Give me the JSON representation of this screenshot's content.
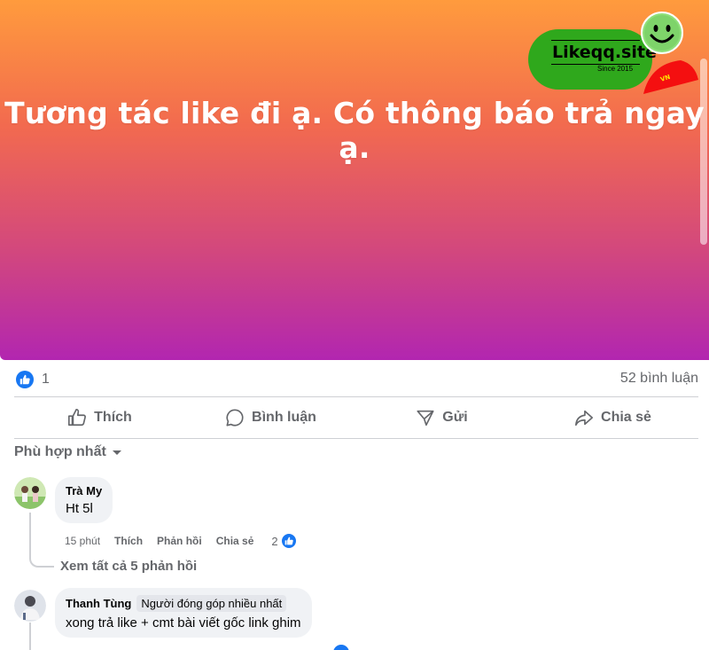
{
  "post": {
    "banner_text": "Tương tác like đi ạ. Có thông báo trả ngay ạ.",
    "logo": {
      "name": "Likeqq.site",
      "since": "Since 2015",
      "flag_text": "VN"
    },
    "banner_colors": [
      "#ff9b3d",
      "#b226b0"
    ]
  },
  "stats": {
    "like_count": "1",
    "comment_count": "52 bình luận"
  },
  "actions": {
    "like": "Thích",
    "comment": "Bình luận",
    "send": "Gửi",
    "share": "Chia sẻ"
  },
  "sort": {
    "label": "Phù hợp nhất"
  },
  "comments": [
    {
      "author": "Trà My",
      "text": "Ht 5l",
      "time": "15 phút",
      "like_label": "Thích",
      "reply_label": "Phản hồi",
      "share_label": "Chia sẻ",
      "reaction_count": "2",
      "view_replies": "Xem tất cả 5 phản hồi"
    },
    {
      "author": "Thanh Tùng",
      "badge": "Người đóng góp nhiều nhất",
      "text": "xong trả like + cmt bài viết gốc link ghim"
    }
  ],
  "colors": {
    "accent": "#1877f2",
    "secondary_text": "#65676b",
    "bubble": "#f0f2f5"
  }
}
